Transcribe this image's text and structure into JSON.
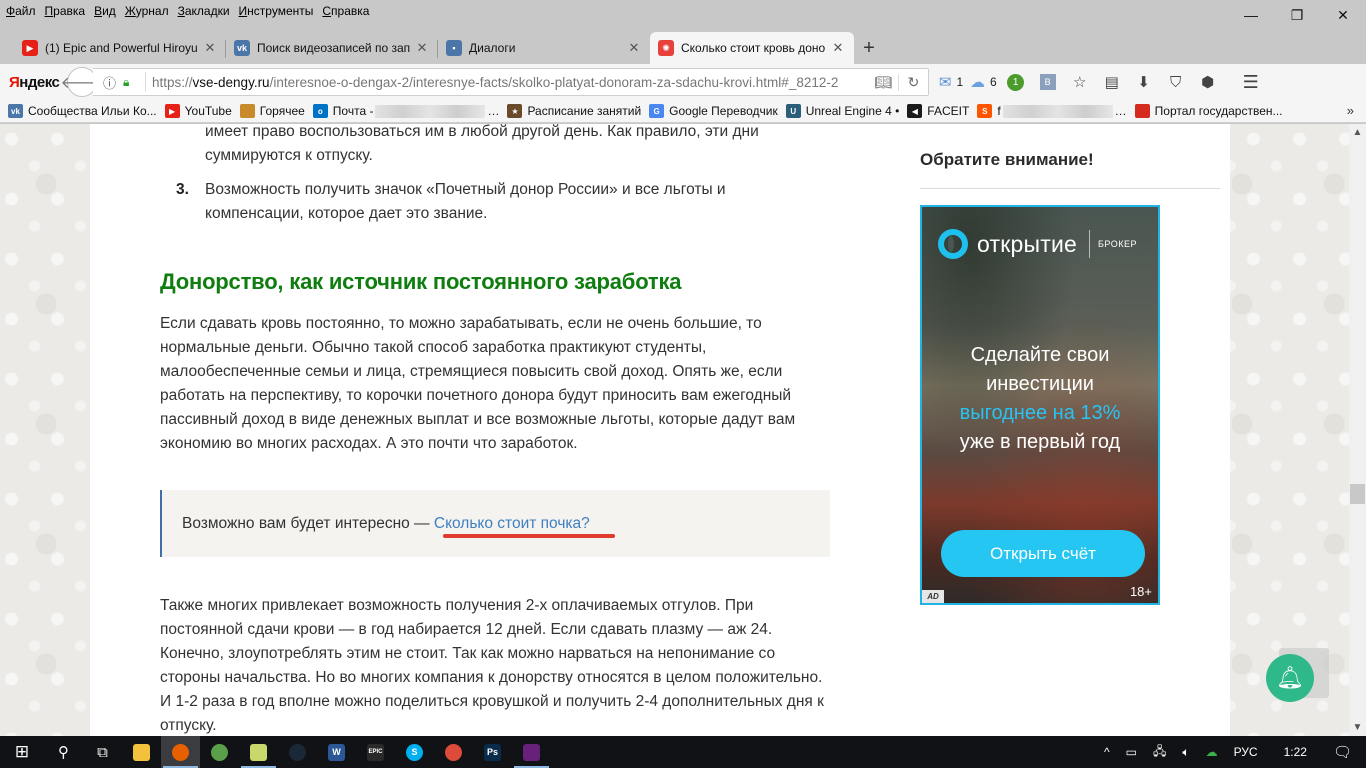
{
  "menu": [
    "Файл",
    "Правка",
    "Вид",
    "Журнал",
    "Закладки",
    "Инструменты",
    "Справка"
  ],
  "window_controls": {
    "minimize": "—",
    "restore": "❐",
    "close": "✕"
  },
  "tabs": [
    {
      "title": "(1) Epic and Powerful Hiroyu",
      "favicon": "youtube-icon",
      "color": "#e62117",
      "active": false
    },
    {
      "title": "Поиск видеозаписей по зап",
      "favicon": "vk-icon",
      "color": "#4a76a8",
      "active": false
    },
    {
      "title": "Диалоги",
      "favicon": "vk-messages-icon",
      "color": "#4a76a8",
      "active": false
    },
    {
      "title": "Сколько стоит кровь донор",
      "favicon": "vse-dengy-icon",
      "color": "#e8413c",
      "active": true
    }
  ],
  "new_tab": "+",
  "nav": {
    "brand_first": "Я",
    "brand_rest": "ндекс",
    "url_prefix": "https://",
    "url_domain": "vse-dengy.ru",
    "url_path": "/interesnoe-o-dengax-2/interesnye-facts/skolko-platyat-donoram-za-sdachu-krovi.html#_8212-2",
    "mail_count": "1",
    "weather_count": "6",
    "badge_count": "1"
  },
  "bookmarks": [
    {
      "label": "Сообщества Ильи Ко...",
      "icon": "vk-icon",
      "color": "#4a76a8",
      "glyph": "vk"
    },
    {
      "label": "YouTube",
      "icon": "youtube-icon",
      "color": "#e62117",
      "glyph": "▶"
    },
    {
      "label": "Горячее",
      "icon": "pikabu-icon",
      "color": "#c98a2b",
      "glyph": ""
    },
    {
      "label": "Почта -",
      "icon": "outlook-icon",
      "color": "#0072c6",
      "glyph": "o",
      "blurred": true
    },
    {
      "label": "Расписание занятий",
      "icon": "star-icon",
      "color": "#6b4a2a",
      "glyph": "★"
    },
    {
      "label": "Google Переводчик",
      "icon": "google-translate-icon",
      "color": "#4a87ee",
      "glyph": "G"
    },
    {
      "label": "Unreal Engine 4 •",
      "icon": "unreal-icon",
      "color": "#2a5e7a",
      "glyph": "U"
    },
    {
      "label": "FACEIT",
      "icon": "faceit-icon",
      "color": "#1a1a1a",
      "glyph": "◀"
    },
    {
      "label": "f",
      "icon": "fs-icon",
      "color": "#ff5500",
      "glyph": "S",
      "blurred": true
    },
    {
      "label": "Портал государствен...",
      "icon": "russia-flag-icon",
      "color": "#d52b1e",
      "glyph": ""
    }
  ],
  "bookmarks_more": "»",
  "article": {
    "list_continuation": "имеет право воспользоваться им в любой другой день. Как правило, эти дни суммируются к отпуску.",
    "item3_number": "3.",
    "item3_text": "Возможность получить значок «Почетный донор России» и все льготы и компенсации, которое дает это звание.",
    "heading": "Донорство, как источник постоянного заработка",
    "paragraph1": "Если сдавать кровь постоянно, то можно зарабатывать, если не очень большие, то нормальные деньги. Обычно такой способ заработка практикуют студенты, малообеспеченные семьи и лица, стремящиеся повысить свой доход. Опять же, если работать на перспективу, то корочки почетного донора будут приносить вам ежегодный пассивный доход в виде денежных выплат и все возможные льготы, которые дадут вам экономию во многих расходах. А это почти что заработок.",
    "callout_prefix": "Возможно вам будет интересно — ",
    "callout_link": "Сколько стоит почка?",
    "paragraph2": "Также многих привлекает возможность получения 2-х оплачиваемых отгулов. При постоянной сдачи крови — в год набирается 12 дней. Если сдавать плазму — аж 24. Конечно, злоупотреблять этим не стоит. Так как можно нарваться на непонимание со стороны начальства. Но во многих компания к донорству относятся в целом положительно. И 1-2 раза в год вполне можно поделиться кровушкой и получить 2-4 дополнительных дня к отпуску."
  },
  "sidebar": {
    "heading": "Обратите внимание!",
    "ad": {
      "brand": "открытие",
      "brand_sub": "БРОКЕР",
      "line1": "Сделайте свои",
      "line2": "инвестиции",
      "line3": "выгоднее на 13%",
      "line4": "уже в первый год",
      "cta": "Открыть счёт",
      "age": "18+",
      "ad_marker": "AD"
    }
  },
  "taskbar": {
    "apps": [
      {
        "name": "file-explorer",
        "color": "#f3c23c",
        "glyph": "",
        "open": false
      },
      {
        "name": "firefox",
        "color": "#e66000",
        "glyph": "",
        "open": true,
        "active": true
      },
      {
        "name": "globe-app",
        "color": "#5aa04a",
        "glyph": "",
        "open": false
      },
      {
        "name": "notepad-app",
        "color": "#c8d86a",
        "glyph": "",
        "open": true
      },
      {
        "name": "steam",
        "color": "#1b2838",
        "glyph": "",
        "open": false
      },
      {
        "name": "word",
        "color": "#2b5797",
        "glyph": "W",
        "open": false
      },
      {
        "name": "epic-games",
        "color": "#2a2a2a",
        "glyph": "EPIC",
        "open": false
      },
      {
        "name": "skype",
        "color": "#00aff0",
        "glyph": "S",
        "open": false
      },
      {
        "name": "chrome",
        "color": "#dd4b39",
        "glyph": "",
        "open": false
      },
      {
        "name": "photoshop",
        "color": "#0b2b4a",
        "glyph": "Ps",
        "open": false
      },
      {
        "name": "visual-studio",
        "color": "#68217a",
        "glyph": "",
        "open": true
      }
    ],
    "language": "РУС",
    "time": "1:22"
  }
}
